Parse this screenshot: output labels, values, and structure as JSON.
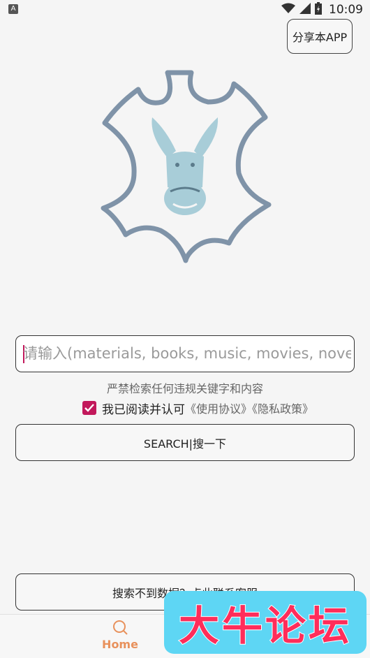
{
  "status_bar": {
    "notification_icon_letter": "A",
    "time": "10:09",
    "icons": [
      "wifi-icon",
      "cellular-signal-icon",
      "battery-icon"
    ]
  },
  "header": {
    "share_label": "分享本APP"
  },
  "logo": {
    "icon": "donkey-leather-logo",
    "outline_color": "#7f93a8",
    "donkey_color": "#a8cdd8"
  },
  "search": {
    "placeholder": "请输入(materials, books, music, movies, novel",
    "value": ""
  },
  "warning_text": "严禁检索任何违规关键字和内容",
  "agreement": {
    "checked": true,
    "label": "我已阅读并认可",
    "links_text": "《使用协议》《隐私政策》"
  },
  "search_button_label": "SEARCH|搜一下",
  "contact_button_label": "搜索不到数据？点此联系客服",
  "bottom_nav": {
    "home_label": "Home",
    "home_icon": "search-icon",
    "active_color": "#e8915c"
  },
  "watermark_text": "大牛论坛",
  "colors": {
    "accent": "#c2185b",
    "watermark_bg": "#5ed6f4",
    "watermark_fg": "#ff2d5a"
  }
}
